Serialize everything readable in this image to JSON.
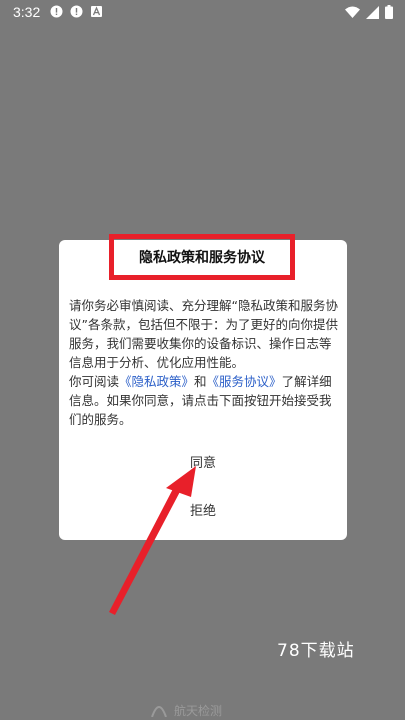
{
  "status_bar": {
    "time": "3:32",
    "icons_left": [
      "alert-circle-icon",
      "alert-circle-icon",
      "app-a-icon"
    ],
    "icons_right": [
      "wifi-icon",
      "signal-icon",
      "battery-icon"
    ]
  },
  "dialog": {
    "title": "隐私政策和服务协议",
    "paragraph1": "请你务必审慎阅读、充分理解“隐私政策和服务协议”各条款，包括但不限于：为了更好的向你提供服务，我们需要收集你的设备标识、操作日志等信息用于分析、优化应用性能。",
    "paragraph2_prefix": "你可阅读",
    "privacy_link": "《隐私政策》",
    "paragraph2_and": "和",
    "service_link": "《服务协议》",
    "paragraph2_suffix": "了解详细信息。如果你同意，请点击下面按钮开始接受我们的服务。",
    "agree_label": "同意",
    "reject_label": "拒绝"
  },
  "watermark": {
    "text": "78下载站"
  },
  "bottom_logo": {
    "text": "航天检测"
  },
  "colors": {
    "overlay": "#7a7a7a",
    "highlight_red": "#e8202a",
    "link_blue": "#2b5fc8"
  }
}
